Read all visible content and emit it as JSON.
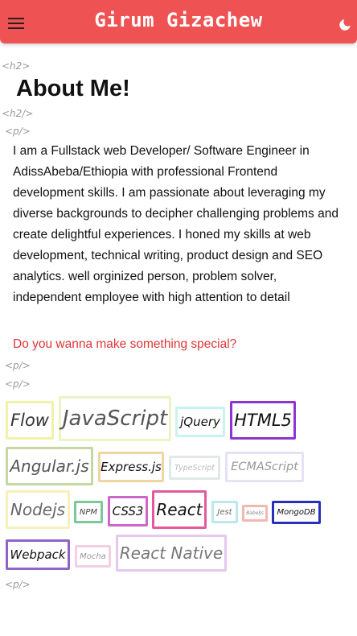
{
  "header": {
    "brand": "Girum Gizachew"
  },
  "tags": {
    "h2_open": "<h2>",
    "h2_close": "<h2/>",
    "p_open": "<p/>",
    "p_close": "<p/>",
    "p_again": "<p/>",
    "p_end": "<p/>"
  },
  "about": {
    "title": "About Me!",
    "paragraph": "I am a Fullstack web Developer/ Software Engineer in AdissAbeba/Ethiopia with professional Frontend development skills. I am passionate about leveraging my diverse backgrounds to decipher challenging problems and create delightful experiences. I honed my skills at web development, technical writing, product design and SEO analytics. well orginized person, problem solver, independent employee with high attention to detail",
    "special": "Do you wanna make something special?"
  },
  "skills": [
    {
      "name": "Flow",
      "border": "#f0f3a8",
      "color": "#333"
    },
    {
      "name": "JavaScript",
      "border": "#eef3c6",
      "color": "#555"
    },
    {
      "name": "jQuery",
      "border": "#c8f3f0",
      "color": "#111"
    },
    {
      "name": "HTML5",
      "border": "#8e35d1",
      "color": "#111"
    },
    {
      "name": "Angular.js",
      "border": "#c3d8a3",
      "color": "#555"
    },
    {
      "name": "Express.js",
      "border": "#efd5a0",
      "color": "#111"
    },
    {
      "name": "TypeScript",
      "border": "#e0e8ec",
      "color": "#bbb"
    },
    {
      "name": "ECMAScript",
      "border": "#eae0f6",
      "color": "#999"
    },
    {
      "name": "Nodejs",
      "border": "#f4f2b8",
      "color": "#666"
    },
    {
      "name": "NPM",
      "border": "#7dc89a",
      "color": "#444"
    },
    {
      "name": "CSS3",
      "border": "#cd67c7",
      "color": "#111"
    },
    {
      "name": "React",
      "border": "#e35a9c",
      "color": "#111"
    },
    {
      "name": "Jest",
      "border": "#bde7ee",
      "color": "#666"
    },
    {
      "name": "BabelJs",
      "border": "#f2b8b0",
      "color": "#888"
    },
    {
      "name": "MongoDB",
      "border": "#2830b8",
      "color": "#111"
    },
    {
      "name": "Webpack",
      "border": "#9163c9",
      "color": "#111"
    },
    {
      "name": "Mocha",
      "border": "#f3cfe3",
      "color": "#999"
    },
    {
      "name": "React Native",
      "border": "#e5c8f0",
      "color": "#777"
    }
  ]
}
